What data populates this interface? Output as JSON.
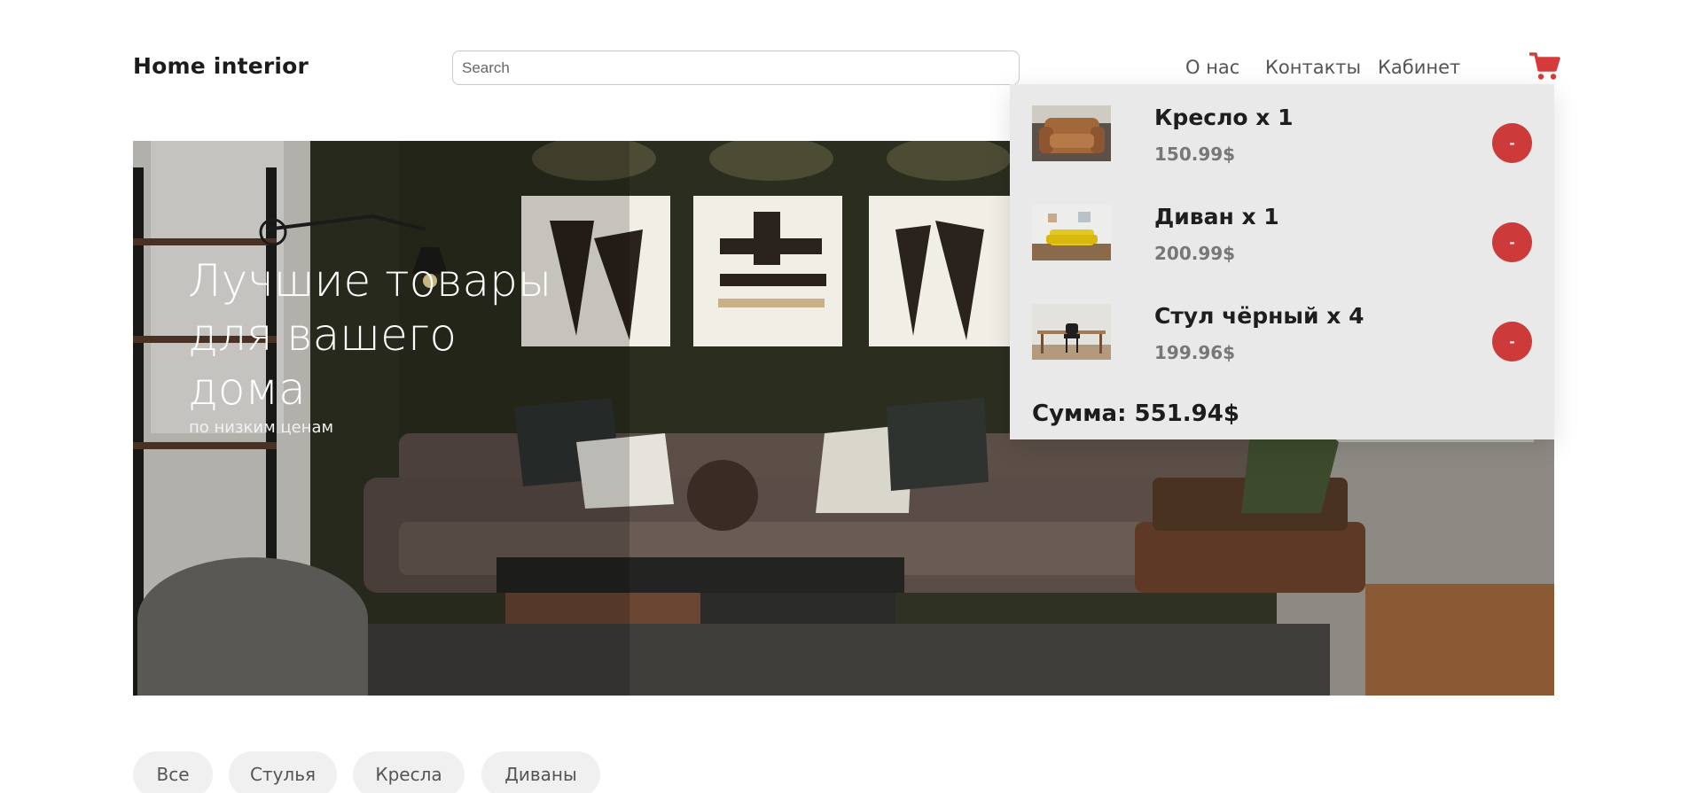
{
  "header": {
    "logo": "Home interior",
    "search_placeholder": "Search",
    "nav": [
      {
        "label": "О нас"
      },
      {
        "label": "Контакты"
      },
      {
        "label": "Кабинет"
      }
    ],
    "cart_icon": "shopping-cart-icon"
  },
  "hero": {
    "title": "Лучшие товары для вашего дома",
    "subtitle": "по низким ценам"
  },
  "cart": {
    "items": [
      {
        "name": "Кресло x 1",
        "price": "150.99$",
        "remove_label": "-"
      },
      {
        "name": "Диван x 1",
        "price": "200.99$",
        "remove_label": "-"
      },
      {
        "name": "Стул чёрный x 4",
        "price": "199.96$",
        "remove_label": "-"
      }
    ],
    "total": "Сумма: 551.94$"
  },
  "filters": [
    {
      "label": "Все"
    },
    {
      "label": "Стулья"
    },
    {
      "label": "Кресла"
    },
    {
      "label": "Диваны"
    }
  ],
  "colors": {
    "accent": "#cc3a3a",
    "cart_panel_bg": "#e9e9e9",
    "filter_bg": "#f0f0f0"
  }
}
